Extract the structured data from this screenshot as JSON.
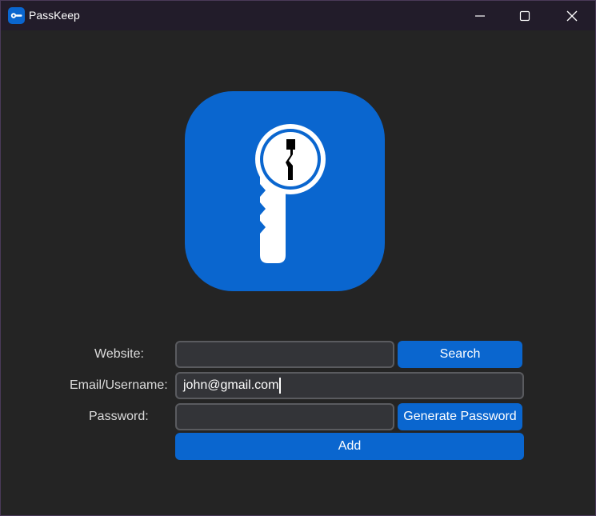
{
  "window": {
    "title": "PassKeep"
  },
  "colors": {
    "accent": "#0a66cf",
    "background": "#242424",
    "titlebar": "#221c2a",
    "field_bg": "#333438",
    "field_border": "#5a5b5f"
  },
  "icons": {
    "app": "key-icon",
    "logo": "key-logo-icon",
    "minimize": "minimize-icon",
    "maximize": "maximize-icon",
    "close": "close-icon"
  },
  "form": {
    "website_label": "Website:",
    "website_value": "",
    "email_label": "Email/Username:",
    "email_value": "john@gmail.com",
    "password_label": "Password:",
    "password_value": "",
    "search_label": "Search",
    "generate_label": "Generate Password",
    "add_label": "Add"
  }
}
